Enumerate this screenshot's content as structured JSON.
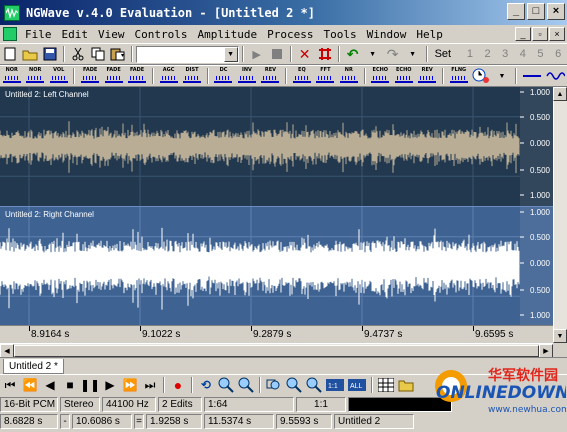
{
  "window": {
    "title": "NGWave v.4.0 Evaluation - [Untitled 2 *]"
  },
  "window_buttons": [
    "_",
    "□",
    "×"
  ],
  "menu": [
    "File",
    "Edit",
    "View",
    "Controls",
    "Amplitude",
    "Process",
    "Tools",
    "Window",
    "Help"
  ],
  "toolbar": {
    "set_label": "Set",
    "set_numbers": [
      "1",
      "2",
      "3",
      "4",
      "5",
      "6"
    ]
  },
  "effects": [
    "NOR",
    "NOR",
    "FADE",
    "FADE",
    "FADE",
    "AGC",
    "DIST",
    "DC",
    "INV",
    "REV",
    "EQ",
    "FFT",
    "NR",
    "ECHO",
    "ECHO",
    "REV",
    "FLNG"
  ],
  "channels": {
    "left": {
      "title": "Untitled 2: Left Channel",
      "scale": [
        "1.000",
        "0.500",
        "0.000",
        "0.500",
        "1.000"
      ]
    },
    "right": {
      "title": "Untitled 2: Right Channel",
      "scale": [
        "1.000",
        "0.500",
        "0.000",
        "0.500",
        "1.000"
      ]
    }
  },
  "time_ruler": [
    "8.9164 s",
    "9.1022 s",
    "9.2879 s",
    "9.4737 s",
    "9.6595 s"
  ],
  "document_tab": "Untitled 2 *",
  "status": {
    "format": "16-Bit PCM",
    "channels": "Stereo",
    "rate": "44100 Hz",
    "edits": "2 Edits",
    "zoom": "1:64",
    "ratio": "1:1",
    "sel_start": "8.6828 s",
    "sel_end": "10.6086 s",
    "sel_len": "1.9258 s",
    "view_start": "11.5374 s",
    "view_end": "9.5593 s",
    "doc": "Untitled 2"
  },
  "watermark": {
    "cn": "华军软件园",
    "brand": "ONLINEDOWN",
    "url": "www.newhua.com"
  },
  "colors": {
    "left_bg": "#21384f",
    "left_wave": "#b9ad95",
    "right_bg": "#3e6292",
    "right_wave": "#ffffff"
  }
}
